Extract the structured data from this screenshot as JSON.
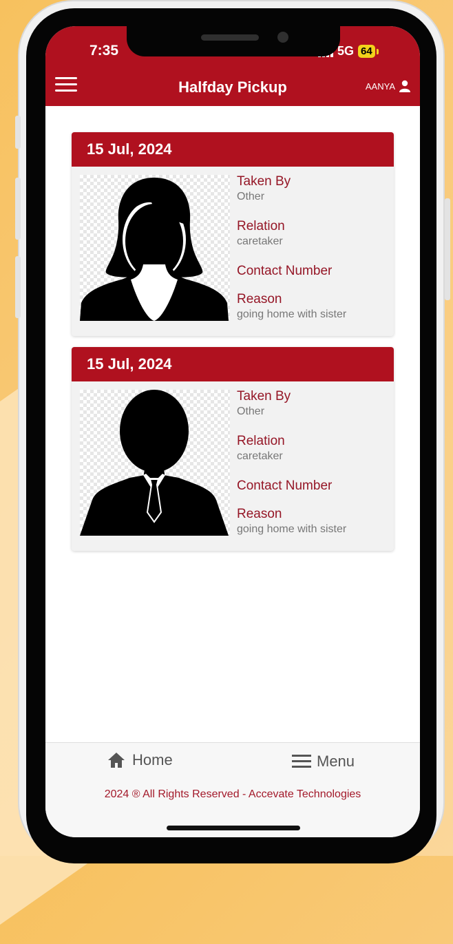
{
  "status_bar": {
    "time": "7:35",
    "network": "5G",
    "battery": "64"
  },
  "header": {
    "title": "Halfday Pickup",
    "user": "AANYA"
  },
  "pickups": [
    {
      "date": "15 Jul, 2024",
      "taken_by_label": "Taken By",
      "taken_by": "Other",
      "relation_label": "Relation",
      "relation": "caretaker",
      "contact_label": "Contact Number",
      "contact": "",
      "reason_label": "Reason",
      "reason": "going home with sister",
      "avatar": "female-avatar-icon"
    },
    {
      "date": "15 Jul, 2024",
      "taken_by_label": "Taken By",
      "taken_by": "Other",
      "relation_label": "Relation",
      "relation": "caretaker",
      "contact_label": "Contact Number",
      "contact": "",
      "reason_label": "Reason",
      "reason": "going home with sister",
      "avatar": "male-avatar-icon"
    }
  ],
  "bottom_nav": {
    "home_label": "Home",
    "menu_label": "Menu"
  },
  "footer": {
    "copyright": "2024 ® All Rights Reserved - Accevate Technologies"
  },
  "colors": {
    "brand": "#b0111f",
    "label": "#951626",
    "muted": "#777777"
  }
}
